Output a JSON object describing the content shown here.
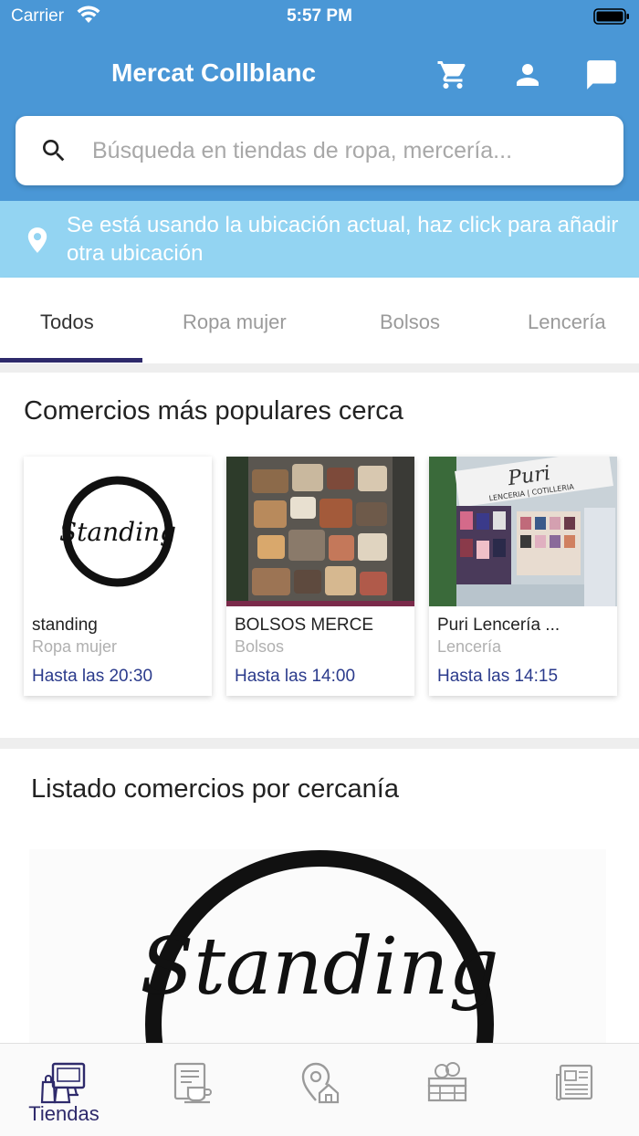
{
  "status_bar": {
    "carrier": "Carrier",
    "time": "5:57 PM"
  },
  "header": {
    "title": "Mercat Collblanc",
    "icons": [
      "cart-icon",
      "user-icon",
      "chat-icon"
    ]
  },
  "search": {
    "placeholder": "Búsqueda en tiendas de ropa, mercería..."
  },
  "location_banner": {
    "text": "Se está usando la ubicación actual, haz click para añadir otra ubicación"
  },
  "tabs": [
    {
      "label": "Todos",
      "active": true
    },
    {
      "label": "Ropa mujer",
      "active": false
    },
    {
      "label": "Bolsos",
      "active": false
    },
    {
      "label": "Lencería",
      "active": false
    }
  ],
  "popular": {
    "title": "Comercios más populares cerca",
    "cards": [
      {
        "name": "standing",
        "category": "Ropa mujer",
        "hours": "Hasta las 20:30",
        "logo_text": "Standing"
      },
      {
        "name": "BOLSOS MERCE",
        "category": "Bolsos",
        "hours": "Hasta las 14:00"
      },
      {
        "name": "Puri Lencería ...",
        "category": "Lencería",
        "hours": "Hasta las 14:15",
        "sign_text": "Puri",
        "sign_subtext": "LENCERIA | COTILLERIA"
      }
    ]
  },
  "listing": {
    "title": "Listado comercios por cercanía",
    "logo_text": "Standing"
  },
  "bottom_nav": {
    "items": [
      {
        "icon": "store-icon",
        "label": "Tiendas",
        "active": true
      },
      {
        "icon": "cafe-icon",
        "label": ""
      },
      {
        "icon": "location-home-icon",
        "label": ""
      },
      {
        "icon": "market-icon",
        "label": ""
      },
      {
        "icon": "news-icon",
        "label": ""
      }
    ]
  },
  "colors": {
    "header_blue": "#4a97d6",
    "banner_light_blue": "#93d4f2",
    "accent_navy": "#2e2a6b",
    "hours_blue": "#2b3b8c"
  }
}
